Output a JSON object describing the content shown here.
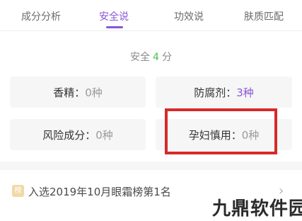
{
  "tabs": [
    {
      "label": "成分分析",
      "active": false
    },
    {
      "label": "安全说",
      "active": true
    },
    {
      "label": "功效说",
      "active": false
    },
    {
      "label": "肤质匹配",
      "active": false
    }
  ],
  "score": {
    "prefix": "安全",
    "value": "4",
    "suffix": "分"
  },
  "cards": {
    "fragrance": {
      "label": "香精：",
      "value": "0种"
    },
    "preservative": {
      "label": "防腐剂：",
      "value": "3种"
    },
    "risk": {
      "label": "风险成分：",
      "value": "0种"
    },
    "pregnancy": {
      "label": "孕妇慎用：",
      "value": "0种"
    }
  },
  "ranking": {
    "badge": "榜",
    "text": "入选2019年10月眼霜榜第1名"
  },
  "watermark": "九鼎软件园",
  "colors": {
    "accent": "#8a56d6",
    "score": "#4cbf50",
    "highlight": "#d62a2a"
  },
  "icons": {
    "chevron": "chevron-right-icon"
  }
}
